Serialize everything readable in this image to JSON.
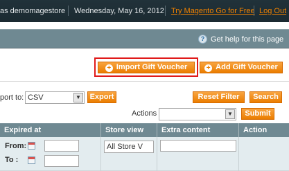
{
  "header": {
    "logged_in_text": "as demomagestore",
    "date": "Wednesday, May 16, 2012",
    "try_link": "Try Magento Go for Free",
    "logout_link": "Log Out"
  },
  "help": {
    "text": "Get help for this page"
  },
  "actions": {
    "import_button": "Import Gift Voucher",
    "add_button": "Add Gift Voucher"
  },
  "toolbar": {
    "export_to_label": "port to:",
    "export_format": "CSV",
    "export_button": "Export",
    "reset_filter_button": "Reset Filter",
    "search_button": "Search",
    "actions_label": "Actions",
    "actions_value": "",
    "submit_button": "Submit"
  },
  "grid": {
    "columns": [
      "Expired at",
      "Store view",
      "Extra content",
      "Action"
    ],
    "filter": {
      "from_label": "From:",
      "to_label": "To :",
      "store_view_value": "All Store V"
    }
  },
  "colors": {
    "accent": "#eb7d00",
    "header_bg": "#21323a",
    "grid_header_bg": "#6f8992",
    "highlight": "#e01a1a"
  }
}
